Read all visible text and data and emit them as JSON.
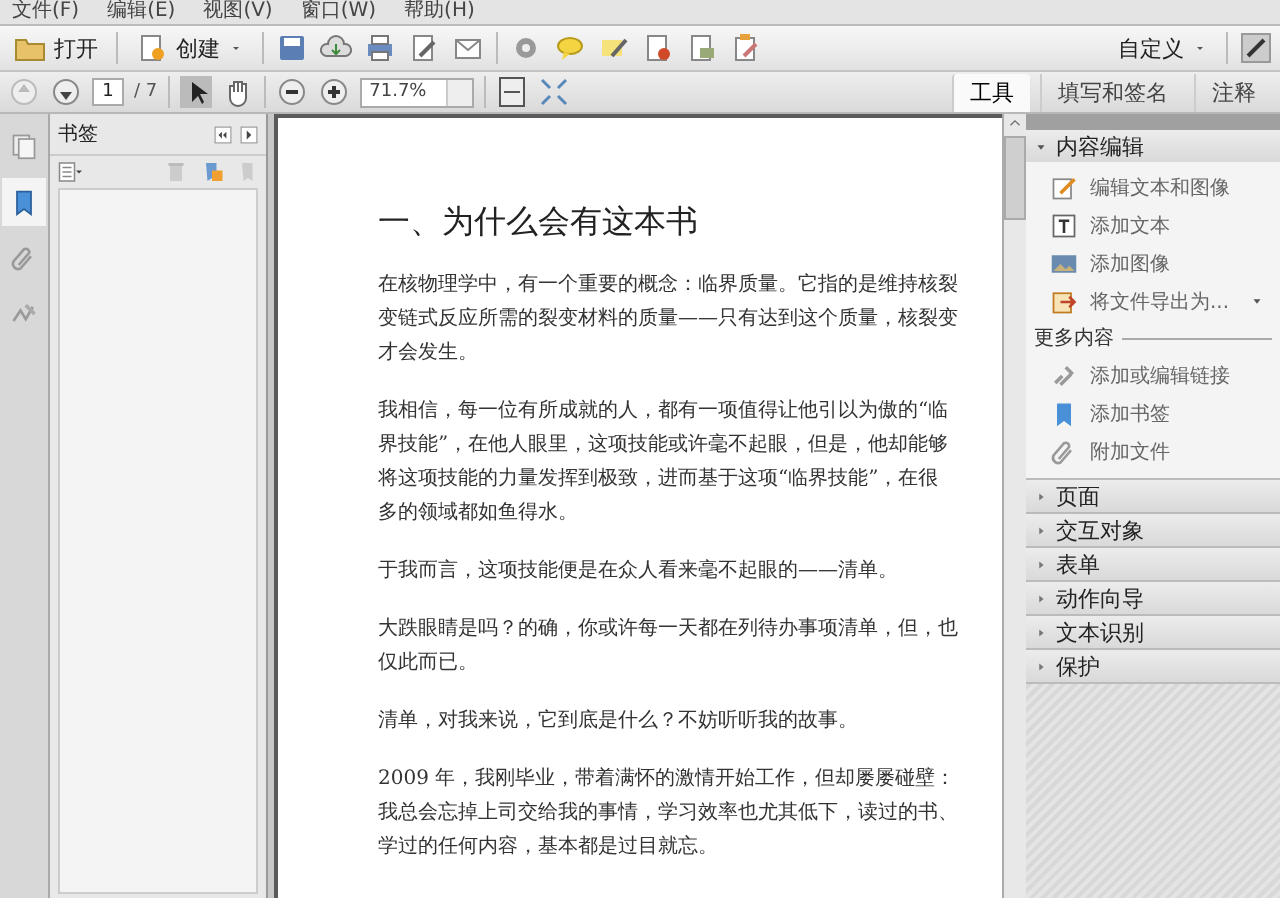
{
  "menu": [
    "文件(F)",
    "编辑(E)",
    "视图(V)",
    "窗口(W)",
    "帮助(H)"
  ],
  "toolbar": {
    "open": "打开",
    "create": "创建",
    "customize": "自定义"
  },
  "nav": {
    "page": "1",
    "page_count": "/ 7",
    "zoom": "71.7%"
  },
  "tabs": [
    {
      "label": "工具",
      "selected": true
    },
    {
      "label": "填写和签名",
      "selected": false
    },
    {
      "label": "注释",
      "selected": false
    }
  ],
  "side_strip": [
    {
      "kind": "pages",
      "selected": false
    },
    {
      "kind": "bookmarks",
      "selected": true
    },
    {
      "kind": "attachments",
      "selected": false
    },
    {
      "kind": "signatures",
      "selected": false
    }
  ],
  "bookmarks_panel": {
    "title": "书签"
  },
  "document": {
    "title": "一、为什么会有这本书",
    "paragraphs": [
      "在核物理学中，有一个重要的概念：临界质量。它指的是维持核裂变链式反应所需的裂变材料的质量——只有达到这个质量，核裂变才会发生。",
      "我相信，每一位有所成就的人，都有一项值得让他引以为傲的“临界技能”，在他人眼里，这项技能或许毫不起眼，但是，他却能够将这项技能的力量发挥到极致，进而基于这项“临界技能”，在很多的领域都如鱼得水。",
      "于我而言，这项技能便是在众人看来毫不起眼的——清单。",
      "大跌眼睛是吗？的确，你或许每一天都在列待办事项清单，但，也仅此而已。",
      "清单，对我来说，它到底是什么？不妨听听我的故事。",
      "2009 年，我刚毕业，带着满怀的激情开始工作，但却屡屡碰壁：我总会忘掉上司交给我的事情，学习效率也尤其低下，读过的书、学过的任何内容，基本都是过目就忘。"
    ]
  },
  "tool_panel": {
    "sections": [
      {
        "title": "内容编辑",
        "expanded": true,
        "items": [
          {
            "label": "编辑文本和图像",
            "kind": "edit"
          },
          {
            "label": "添加文本",
            "kind": "text"
          },
          {
            "label": "添加图像",
            "kind": "image"
          },
          {
            "label": "将文件导出为...",
            "kind": "export"
          }
        ],
        "subheading": "更多内容",
        "more_items": [
          {
            "label": "添加或编辑链接",
            "kind": "link"
          },
          {
            "label": "添加书签",
            "kind": "bookmark"
          },
          {
            "label": "附加文件",
            "kind": "attach"
          }
        ]
      },
      {
        "title": "页面",
        "expanded": false
      },
      {
        "title": "交互对象",
        "expanded": false
      },
      {
        "title": "表单",
        "expanded": false
      },
      {
        "title": "动作向导",
        "expanded": false
      },
      {
        "title": "文本识别",
        "expanded": false
      },
      {
        "title": "保护",
        "expanded": false
      }
    ]
  }
}
